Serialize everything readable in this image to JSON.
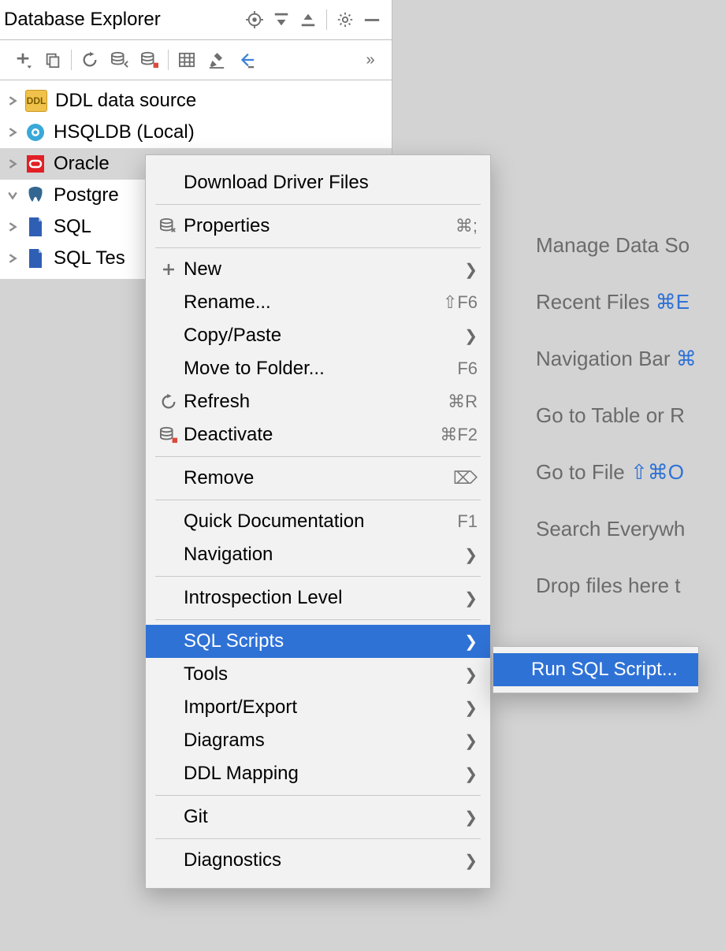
{
  "panel": {
    "title": "Database Explorer"
  },
  "tree": [
    {
      "label": "DDL data source",
      "expanded": false,
      "icon": "ddl"
    },
    {
      "label": "HSQLDB (Local)",
      "expanded": false,
      "icon": "hsqldb"
    },
    {
      "label": "Oracle",
      "expanded": false,
      "icon": "oracle",
      "selected": true
    },
    {
      "label": "Postgre",
      "expanded": true,
      "icon": "postgres"
    },
    {
      "label": "SQL",
      "expanded": false,
      "icon": "sql-blue"
    },
    {
      "label": "SQL Tes",
      "expanded": false,
      "icon": "sql-blue"
    }
  ],
  "context_menu": {
    "groups": [
      [
        {
          "label": "Download Driver Files",
          "icon": null,
          "shortcut": null,
          "submenu": false
        }
      ],
      [
        {
          "label": "Properties",
          "icon": "properties",
          "shortcut": "⌘;",
          "submenu": false
        }
      ],
      [
        {
          "label": "New",
          "icon": "plus",
          "shortcut": null,
          "submenu": true
        },
        {
          "label": "Rename...",
          "icon": null,
          "shortcut": "⇧F6",
          "submenu": false
        },
        {
          "label": "Copy/Paste",
          "icon": null,
          "shortcut": null,
          "submenu": true
        },
        {
          "label": "Move to Folder...",
          "icon": null,
          "shortcut": "F6",
          "submenu": false
        },
        {
          "label": "Refresh",
          "icon": "refresh",
          "shortcut": "⌘R",
          "submenu": false
        },
        {
          "label": "Deactivate",
          "icon": "deactivate",
          "shortcut": "⌘F2",
          "submenu": false
        }
      ],
      [
        {
          "label": "Remove",
          "icon": null,
          "shortcut": "⌦",
          "submenu": false
        }
      ],
      [
        {
          "label": "Quick Documentation",
          "icon": null,
          "shortcut": "F1",
          "submenu": false
        },
        {
          "label": "Navigation",
          "icon": null,
          "shortcut": null,
          "submenu": true
        }
      ],
      [
        {
          "label": "Introspection Level",
          "icon": null,
          "shortcut": null,
          "submenu": true
        }
      ],
      [
        {
          "label": "SQL Scripts",
          "icon": null,
          "shortcut": null,
          "submenu": true,
          "highlight": true
        },
        {
          "label": "Tools",
          "icon": null,
          "shortcut": null,
          "submenu": true
        },
        {
          "label": "Import/Export",
          "icon": null,
          "shortcut": null,
          "submenu": true
        },
        {
          "label": "Diagrams",
          "icon": null,
          "shortcut": null,
          "submenu": true
        },
        {
          "label": "DDL Mapping",
          "icon": null,
          "shortcut": null,
          "submenu": true
        }
      ],
      [
        {
          "label": "Git",
          "icon": null,
          "shortcut": null,
          "submenu": true
        }
      ],
      [
        {
          "label": "Diagnostics",
          "icon": null,
          "shortcut": null,
          "submenu": true
        }
      ]
    ]
  },
  "submenu": {
    "items": [
      "Run SQL Script..."
    ]
  },
  "rightlinks": [
    {
      "text": "Manage Data So",
      "kbd": ""
    },
    {
      "text": "Recent Files ",
      "kbd": "⌘E"
    },
    {
      "text": "Navigation Bar ",
      "kbd": "⌘"
    },
    {
      "text": "Go to Table or R",
      "kbd": ""
    },
    {
      "text": "Go to File ",
      "kbd": "⇧⌘O"
    },
    {
      "text": "Search Everywh",
      "kbd": ""
    },
    {
      "text": "Drop files here t",
      "kbd": ""
    }
  ]
}
